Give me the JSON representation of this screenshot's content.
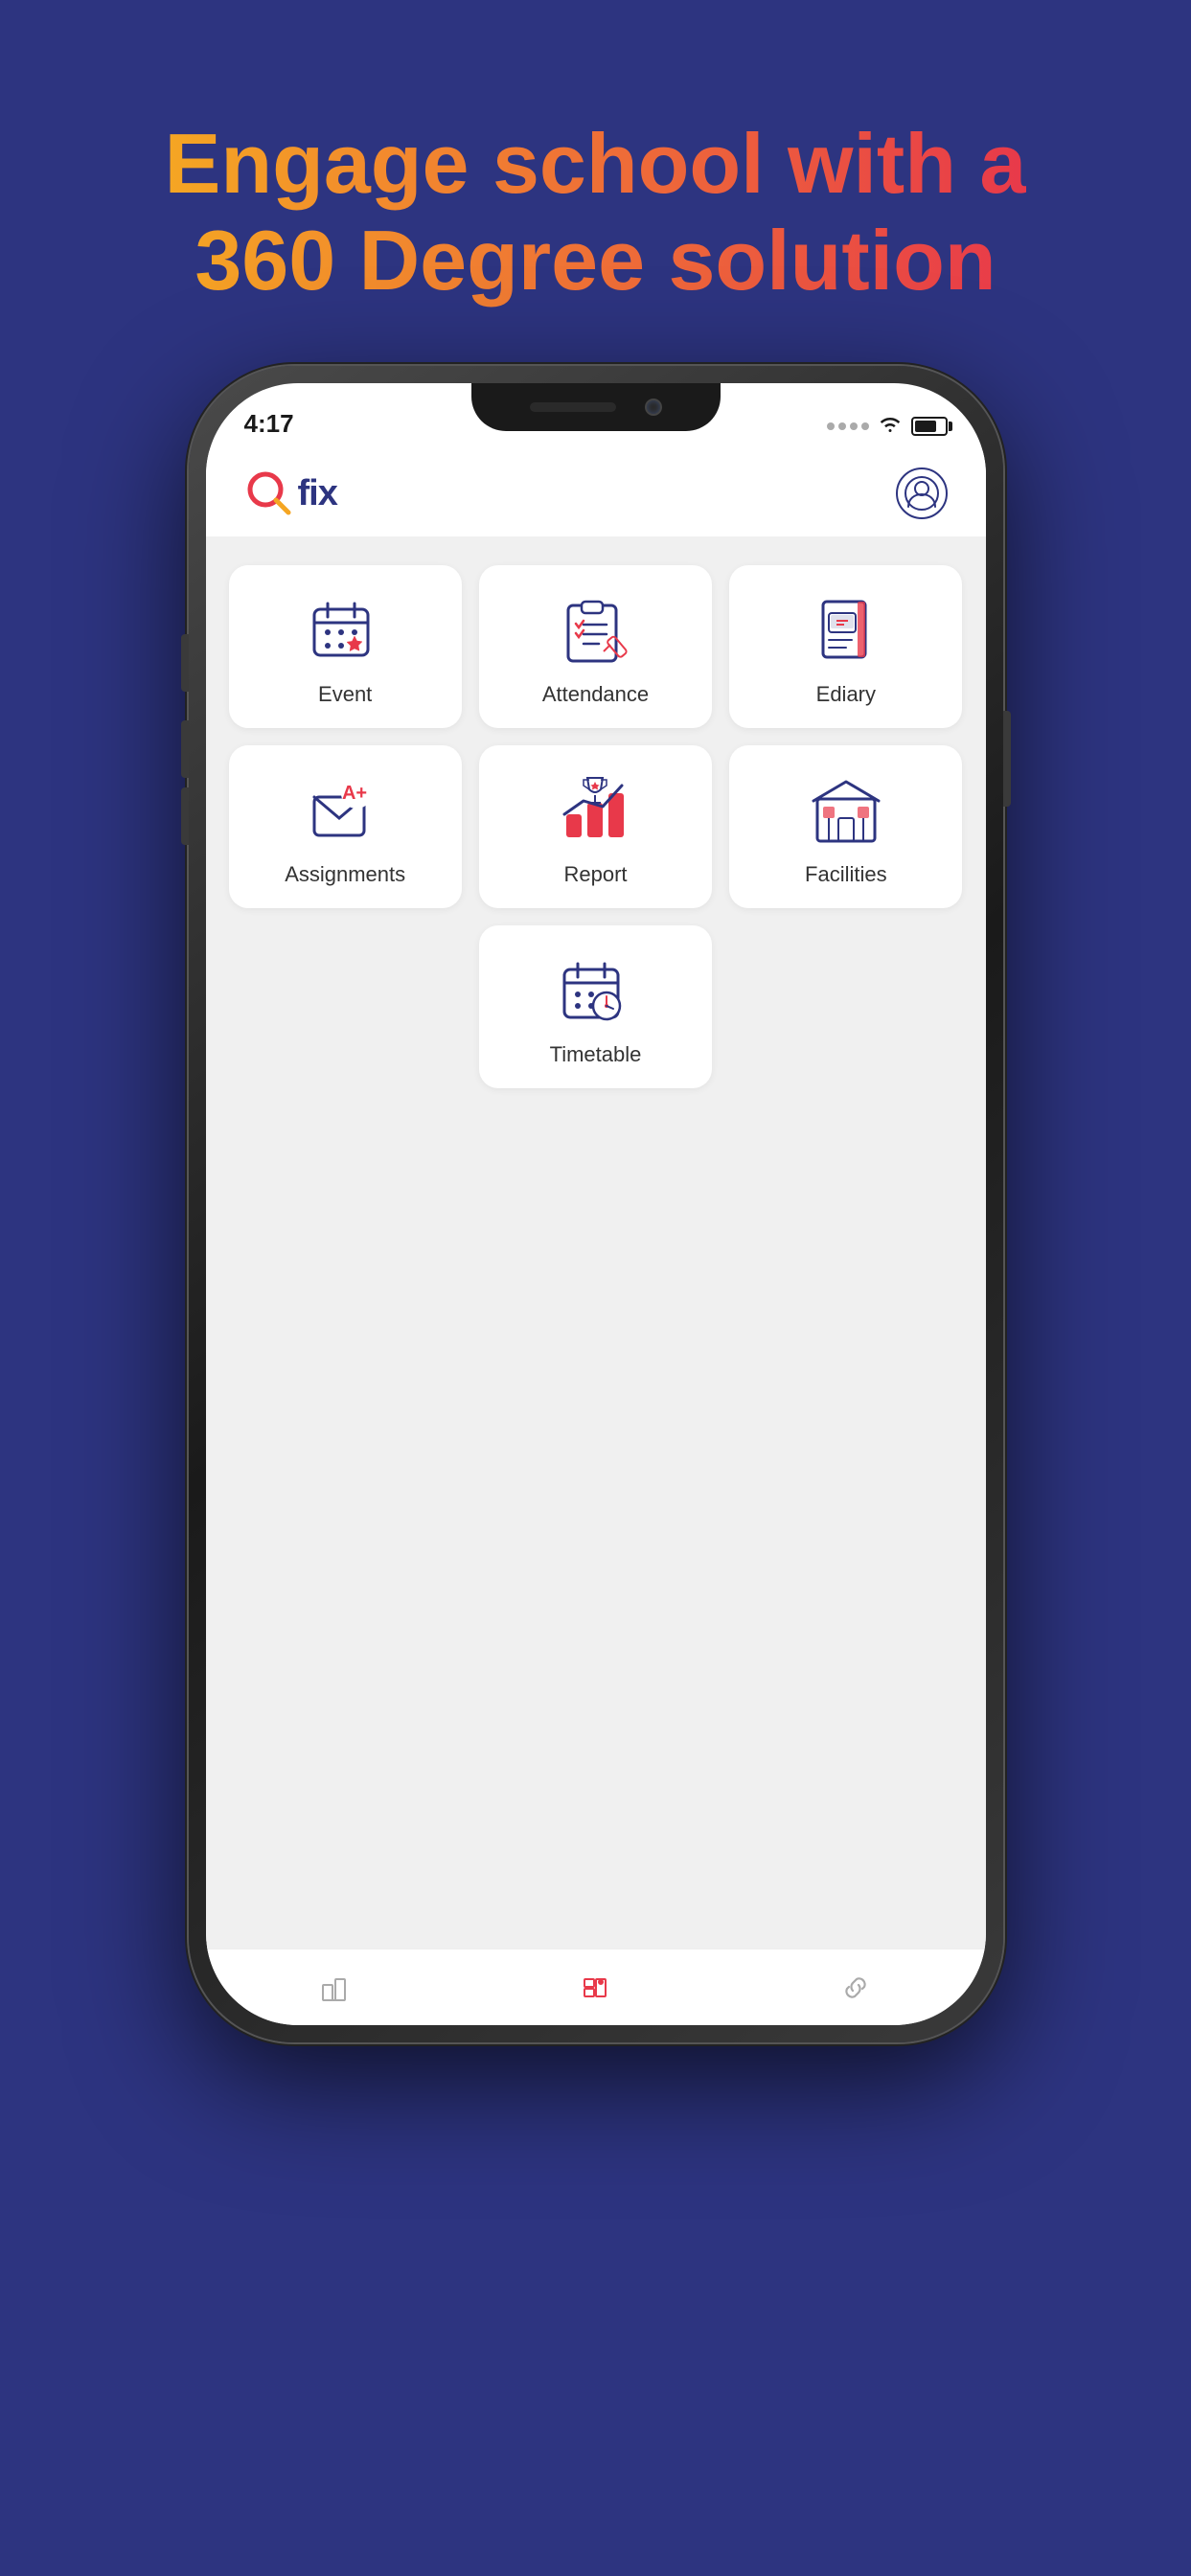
{
  "headline": {
    "line1": "Engage school with a",
    "line2": "360 Degree solution"
  },
  "status": {
    "time": "4:17"
  },
  "header": {
    "logo_text": "fix",
    "user_label": "User profile"
  },
  "menu_items": [
    {
      "id": "event",
      "label": "Event",
      "icon": "event"
    },
    {
      "id": "attendance",
      "label": "Attendance",
      "icon": "attendance"
    },
    {
      "id": "ediary",
      "label": "Ediary",
      "icon": "ediary"
    },
    {
      "id": "assignments",
      "label": "Assignments",
      "icon": "assignments"
    },
    {
      "id": "report",
      "label": "Report",
      "icon": "report"
    },
    {
      "id": "facilities",
      "label": "Facilities",
      "icon": "facilities"
    },
    {
      "id": "timetable",
      "label": "Timetable",
      "icon": "timetable"
    }
  ],
  "bottom_nav": [
    {
      "id": "dashboard",
      "label": "Dashboard",
      "active": false
    },
    {
      "id": "home",
      "label": "Home",
      "active": true
    },
    {
      "id": "link",
      "label": "Link",
      "active": false
    }
  ]
}
